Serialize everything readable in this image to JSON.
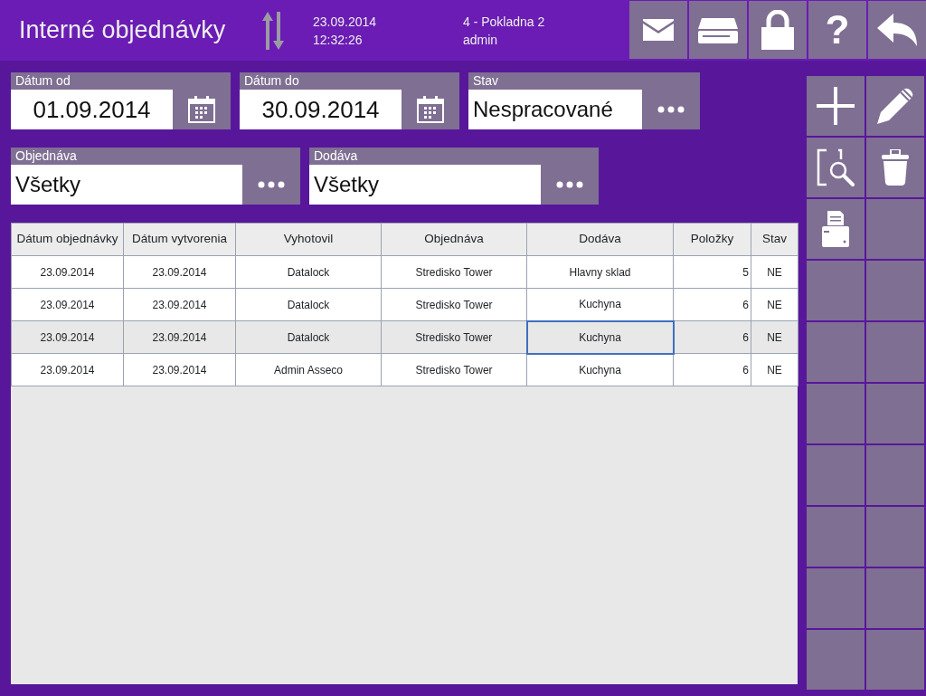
{
  "header": {
    "title": "Interné objednávky",
    "date": "23.09.2014",
    "time": "12:32:26",
    "register": "4 - Pokladna 2",
    "user": "admin",
    "buttons": [
      {
        "kind": "mail"
      },
      {
        "kind": "tray"
      },
      {
        "kind": "lock"
      },
      {
        "kind": "help",
        "glyph": "?"
      },
      {
        "kind": "back"
      }
    ]
  },
  "filters": [
    [
      {
        "label": "Dátum od",
        "value": "01.09.2014",
        "kind": "date"
      },
      {
        "label": "Dátum do",
        "value": "30.09.2014",
        "kind": "date"
      },
      {
        "label": "Stav",
        "value": "Nespracované",
        "kind": "choice"
      }
    ],
    [
      {
        "label": "Objednáva",
        "value": "Všetky",
        "kind": "choice"
      },
      {
        "label": "Dodáva",
        "value": "Všetky",
        "kind": "choice"
      }
    ]
  ],
  "table": {
    "columns": [
      "Dátum objednávky",
      "Dátum vytvorenia",
      "Vyhotovil",
      "Objednáva",
      "Dodáva",
      "Položky",
      "Stav"
    ],
    "rows": [
      {
        "selected": false,
        "cells": [
          {
            "text": "23.09.2014",
            "focused": false
          },
          {
            "text": "23.09.2014",
            "focused": false
          },
          {
            "text": "Datalock",
            "focused": false
          },
          {
            "text": "Stredisko Tower",
            "focused": false
          },
          {
            "text": "Hlavny sklad",
            "focused": false
          },
          {
            "text": "5",
            "focused": false
          },
          {
            "text": "NE",
            "focused": false
          }
        ]
      },
      {
        "selected": false,
        "cells": [
          {
            "text": "23.09.2014",
            "focused": false
          },
          {
            "text": "23.09.2014",
            "focused": false
          },
          {
            "text": "Datalock",
            "focused": false
          },
          {
            "text": "Stredisko Tower",
            "focused": false
          },
          {
            "text": "Kuchyna",
            "focused": false
          },
          {
            "text": "6",
            "focused": false
          },
          {
            "text": "NE",
            "focused": false
          }
        ]
      },
      {
        "selected": true,
        "cells": [
          {
            "text": "23.09.2014",
            "focused": false
          },
          {
            "text": "23.09.2014",
            "focused": false
          },
          {
            "text": "Datalock",
            "focused": false
          },
          {
            "text": "Stredisko Tower",
            "focused": false
          },
          {
            "text": "Kuchyna",
            "focused": true
          },
          {
            "text": "6",
            "focused": false
          },
          {
            "text": "NE",
            "focused": false
          }
        ]
      },
      {
        "selected": false,
        "cells": [
          {
            "text": "23.09.2014",
            "focused": false
          },
          {
            "text": "23.09.2014",
            "focused": false
          },
          {
            "text": "Admin Asseco",
            "focused": false
          },
          {
            "text": "Stredisko Tower",
            "focused": false
          },
          {
            "text": "Kuchyna",
            "focused": false
          },
          {
            "text": "6",
            "focused": false
          },
          {
            "text": "NE",
            "focused": false
          }
        ]
      }
    ]
  },
  "toolbar": [
    {
      "kind": "plus"
    },
    {
      "kind": "pencil"
    },
    {
      "kind": "search"
    },
    {
      "kind": "trash"
    },
    {
      "kind": "printer"
    },
    {
      "kind": "empty"
    },
    {
      "kind": "empty"
    },
    {
      "kind": "empty"
    },
    {
      "kind": "empty"
    },
    {
      "kind": "empty"
    },
    {
      "kind": "empty"
    },
    {
      "kind": "empty"
    },
    {
      "kind": "empty"
    },
    {
      "kind": "empty"
    },
    {
      "kind": "empty"
    },
    {
      "kind": "empty"
    },
    {
      "kind": "empty"
    },
    {
      "kind": "empty"
    },
    {
      "kind": "empty"
    },
    {
      "kind": "empty"
    }
  ]
}
